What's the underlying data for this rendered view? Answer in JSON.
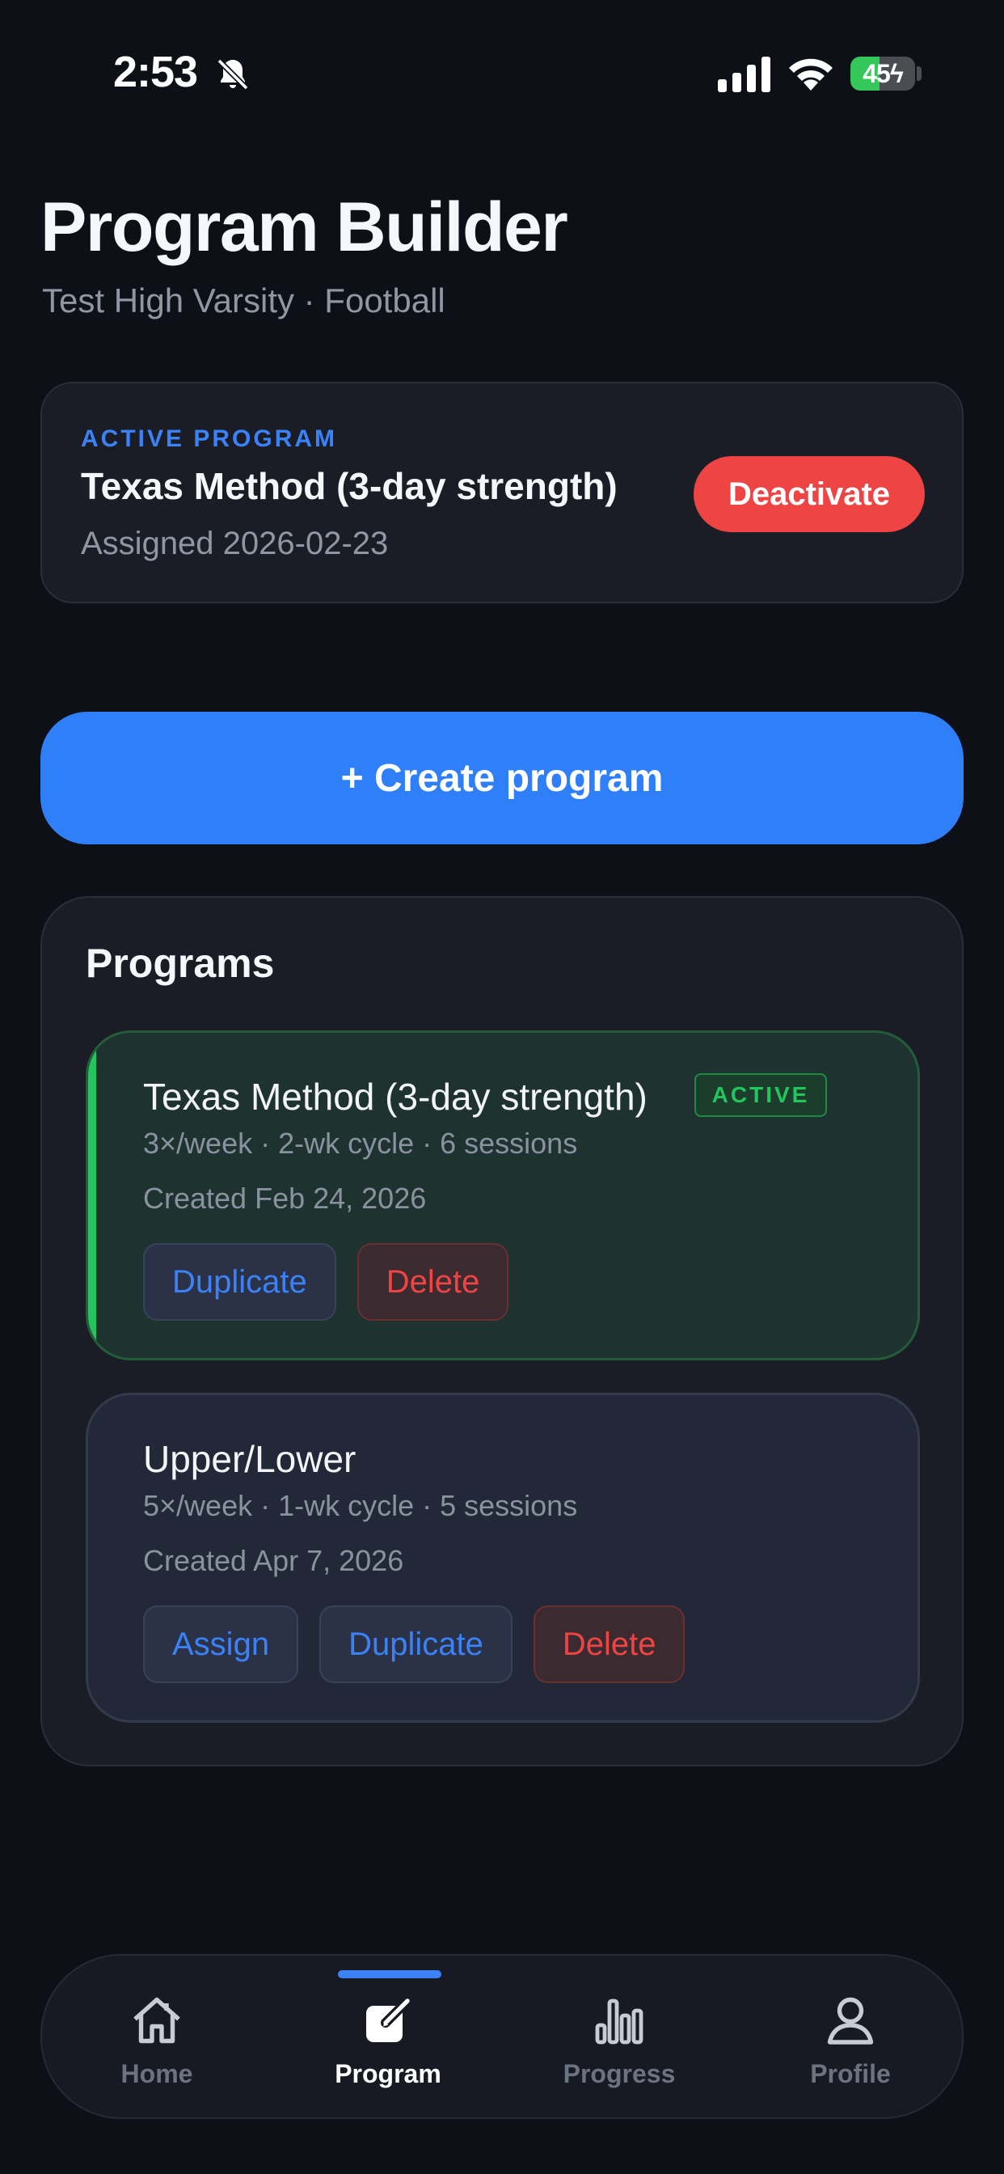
{
  "status_bar": {
    "time": "2:53",
    "battery_level": "45",
    "battery_fraction": 0.45,
    "icons": [
      "bell-slash-icon",
      "signal-icon",
      "wifi-icon",
      "battery-icon"
    ]
  },
  "header": {
    "title": "Program Builder",
    "subtitle": "Test High Varsity · Football"
  },
  "active_program": {
    "eyebrow": "ACTIVE PROGRAM",
    "name": "Texas Method (3-day strength)",
    "assigned": "Assigned 2026-02-23",
    "deactivate_label": "Deactivate"
  },
  "create_button": {
    "label": "+ Create program"
  },
  "programs": {
    "title": "Programs",
    "items": [
      {
        "name": "Texas Method (3-day strength)",
        "badge": "ACTIVE",
        "meta": "3×/week · 2-wk cycle · 6 sessions",
        "created": "Created Feb 24, 2026",
        "actions": [
          "Duplicate",
          "Delete"
        ]
      },
      {
        "name": "Upper/Lower",
        "meta": "5×/week · 1-wk cycle · 5 sessions",
        "created": "Created Apr 7, 2026",
        "actions": [
          "Assign",
          "Duplicate",
          "Delete"
        ]
      }
    ]
  },
  "tab_bar": {
    "selected": "Program",
    "tabs": [
      {
        "label": "Home",
        "icon": "home-icon"
      },
      {
        "label": "Program",
        "icon": "edit-icon"
      },
      {
        "label": "Progress",
        "icon": "bar-chart-icon"
      },
      {
        "label": "Profile",
        "icon": "person-icon"
      }
    ]
  },
  "colors": {
    "background": "#0d1016",
    "accent_blue": "#2f80f8",
    "danger_red": "#ef4444",
    "active_green": "#22c55e"
  }
}
